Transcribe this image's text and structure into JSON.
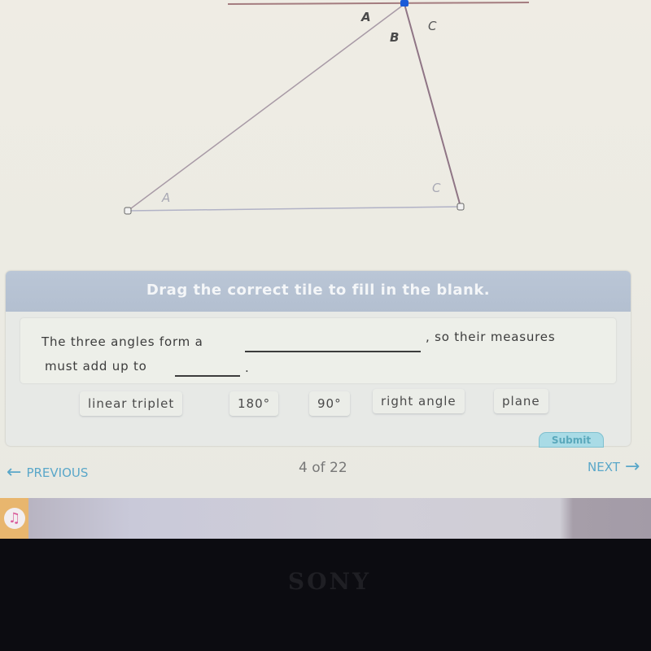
{
  "diagram": {
    "top_labels": {
      "a": "A",
      "b": "B",
      "c": "C"
    },
    "bottom_labels": {
      "a": "A",
      "c": "C"
    }
  },
  "activity": {
    "instruction": "Drag the correct tile to fill in the blank.",
    "sentence_part1": "The three angles form a",
    "sentence_part2": ", so their measures",
    "sentence_part3": "must add up to",
    "sentence_end": ".",
    "tiles": [
      "linear triplet",
      "180°",
      "90°",
      "right angle",
      "plane"
    ],
    "submit_label": "Submit"
  },
  "navigation": {
    "previous_label": "PREVIOUS",
    "next_label": "NEXT",
    "page_indicator": "4 of 22",
    "left_arrow": "←",
    "right_arrow": "→"
  },
  "taskbar": {
    "music_icon": "♫"
  },
  "monitor": {
    "brand": "SONY"
  },
  "colors": {
    "nav_accent": "#5aa7c9",
    "header_bg": "#b3bfd0",
    "vertex_blue": "#1a5bd8"
  }
}
